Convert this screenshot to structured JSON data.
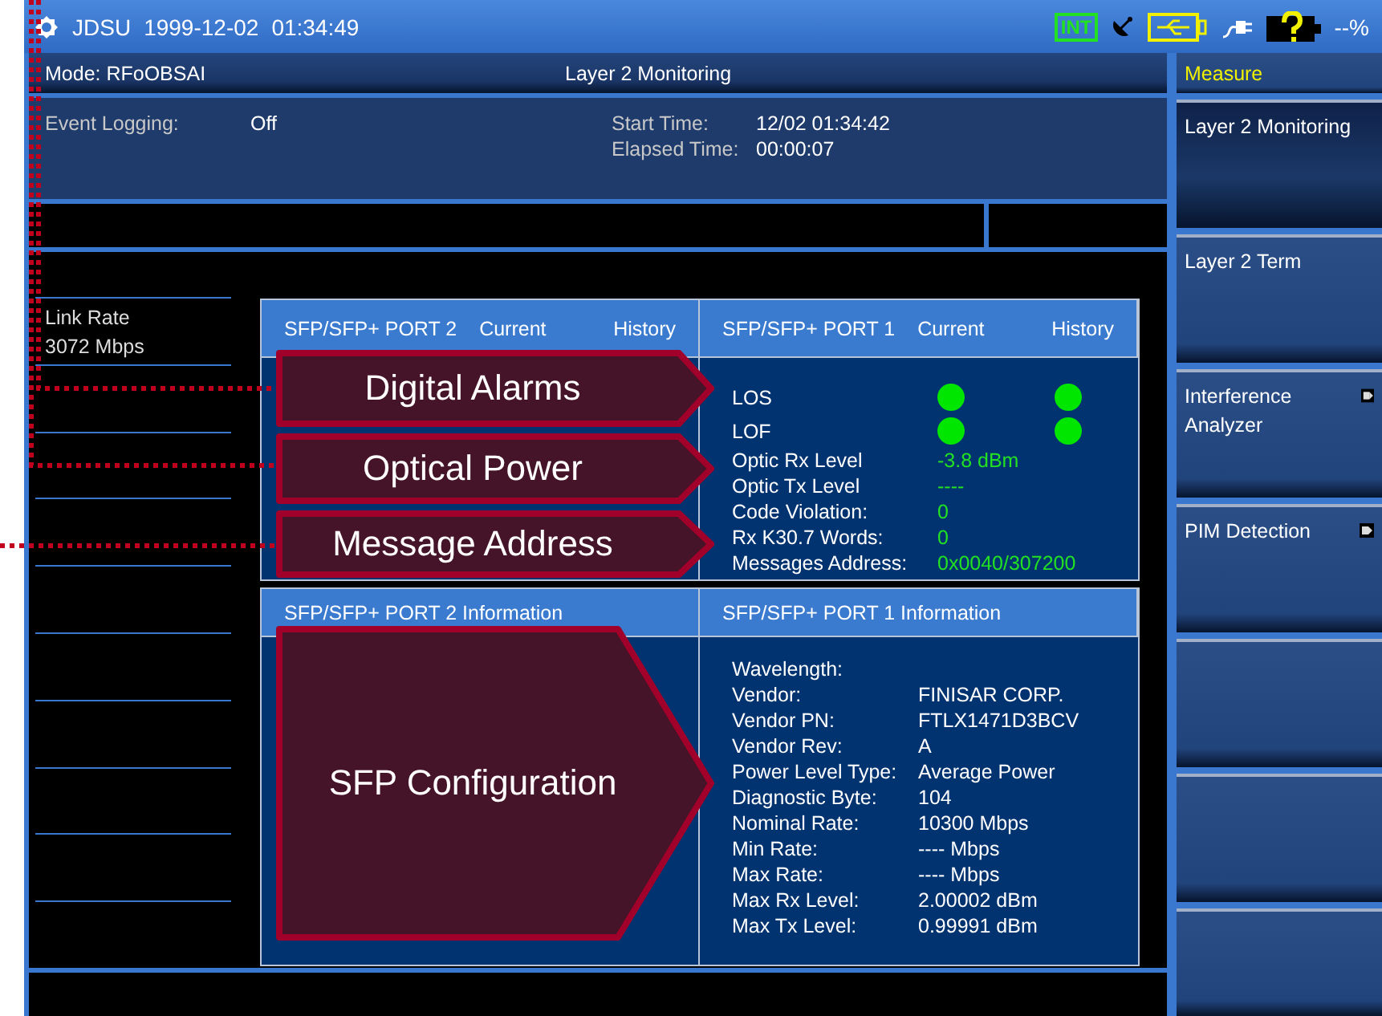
{
  "status_bar": {
    "brand": "JDSU",
    "date": "1999-12-02",
    "time": "01:34:49",
    "int_badge": "INT",
    "battery": "--%"
  },
  "mode_bar": {
    "mode": "Mode: RFoOBSAI",
    "title": "Layer 2 Monitoring"
  },
  "event_logging": {
    "label": "Event Logging:",
    "value": "Off"
  },
  "times": [
    {
      "label": "Start Time:",
      "value": "12/02 01:34:42"
    },
    {
      "label": "Elapsed Time:",
      "value": "00:00:07"
    }
  ],
  "side_list": [
    {
      "label": "Link Rate",
      "value": "3072 Mbps"
    }
  ],
  "alarm_panels": [
    {
      "port": "SFP/SFP+ PORT 2",
      "current": "Current",
      "history": "History"
    },
    {
      "port": "SFP/SFP+ PORT 1",
      "current": "Current",
      "history": "History",
      "alarms": [
        {
          "label": "LOS",
          "current_alarm": false,
          "history_alarm": false
        },
        {
          "label": "LOF",
          "current_alarm": false,
          "history_alarm": false
        }
      ],
      "measures": [
        {
          "label": "Optic Rx Level",
          "value": "-3.8 dBm"
        },
        {
          "label": "Optic Tx Level",
          "value": "----"
        },
        {
          "label": "Code Violation:",
          "value": "0"
        },
        {
          "label": "Rx K30.7 Words:",
          "value": "0"
        },
        {
          "label": "Messages Address:",
          "value": "0x0040/307200"
        }
      ]
    }
  ],
  "info_panels": [
    {
      "title": "SFP/SFP+ PORT 2  Information"
    },
    {
      "title": "SFP/SFP+ PORT 1  Information",
      "fields": [
        {
          "label": "Wavelength:"
        },
        {
          "label": "Vendor:",
          "value": "FINISAR CORP."
        },
        {
          "label": "Vendor PN:",
          "value": "FTLX1471D3BCV"
        },
        {
          "label": "Vendor Rev:",
          "value": "A"
        },
        {
          "label": "Power Level Type:",
          "value": "Average Power"
        },
        {
          "label": "Diagnostic Byte:",
          "value": "104"
        },
        {
          "label": "Nominal Rate:",
          "value": "10300 Mbps"
        },
        {
          "label": "Min Rate:",
          "value": "---- Mbps"
        },
        {
          "label": "Max Rate:",
          "value": "---- Mbps"
        },
        {
          "label": "Max Rx Level:",
          "value": "2.00002 dBm"
        },
        {
          "label": "Max Tx Level:",
          "value": "0.99991 dBm"
        }
      ]
    }
  ],
  "softkeys": [
    {
      "label": "Measure",
      "kind": "title",
      "selected": false
    },
    {
      "label": "Layer 2 Monitoring",
      "kind": "key",
      "selected": true
    },
    {
      "label": "Layer 2 Term",
      "kind": "key",
      "selected": false
    },
    {
      "label": "Interference Analyzer",
      "kind": "submenu",
      "selected": false
    },
    {
      "label": "PIM Detection",
      "kind": "submenu",
      "selected": false
    }
  ],
  "callouts": [
    {
      "text": "Digital Alarms"
    },
    {
      "text": "Optical Power"
    },
    {
      "text": "Message Address"
    },
    {
      "text": "SFP Configuration"
    }
  ]
}
